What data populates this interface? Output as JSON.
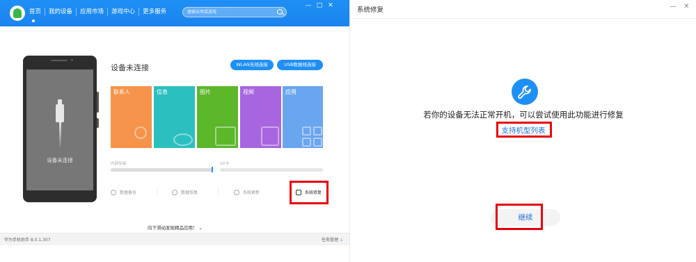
{
  "left": {
    "nav": [
      "首页",
      "我的设备",
      "应用市场",
      "游戏中心",
      "更多服务"
    ],
    "search_placeholder": "搜索应用或游戏",
    "window_controls": [
      "—",
      "□",
      "✕"
    ],
    "phone_text": "设备未连接",
    "status": "设备未连接",
    "wlan_button": "WLAN无线连接",
    "usb_button": "USB数据线连接",
    "tiles": [
      {
        "label": "联系人",
        "color": "#f5934a"
      },
      {
        "label": "信息",
        "color": "#2cbfbf"
      },
      {
        "label": "图片",
        "color": "#5cb72a"
      },
      {
        "label": "视频",
        "color": "#a765e0"
      },
      {
        "label": "应用",
        "color": "#6aa5ef"
      }
    ],
    "internal_storage_label": "内部存储",
    "sd_label": "SD卡",
    "tools": [
      {
        "label": "数据备份",
        "icon": "backup-icon"
      },
      {
        "label": "数据恢复",
        "icon": "restore-icon"
      },
      {
        "label": "系统更新",
        "icon": "update-icon"
      },
      {
        "label": "系统修复",
        "icon": "wrench-icon"
      }
    ],
    "scroll_hint": "向下滑动发现精品应用！",
    "version": "华为手机助手 8.0.1.307",
    "task_manager": "任务管理"
  },
  "right": {
    "title": "系统修复",
    "window_controls": [
      "—",
      "✕"
    ],
    "description": "若你的设备无法正常开机，可以尝试使用此功能进行修复",
    "link": "支持机型列表",
    "continue_button": "继续"
  },
  "colors": {
    "accent": "#1e8ff5",
    "highlight": "#e8000b"
  }
}
